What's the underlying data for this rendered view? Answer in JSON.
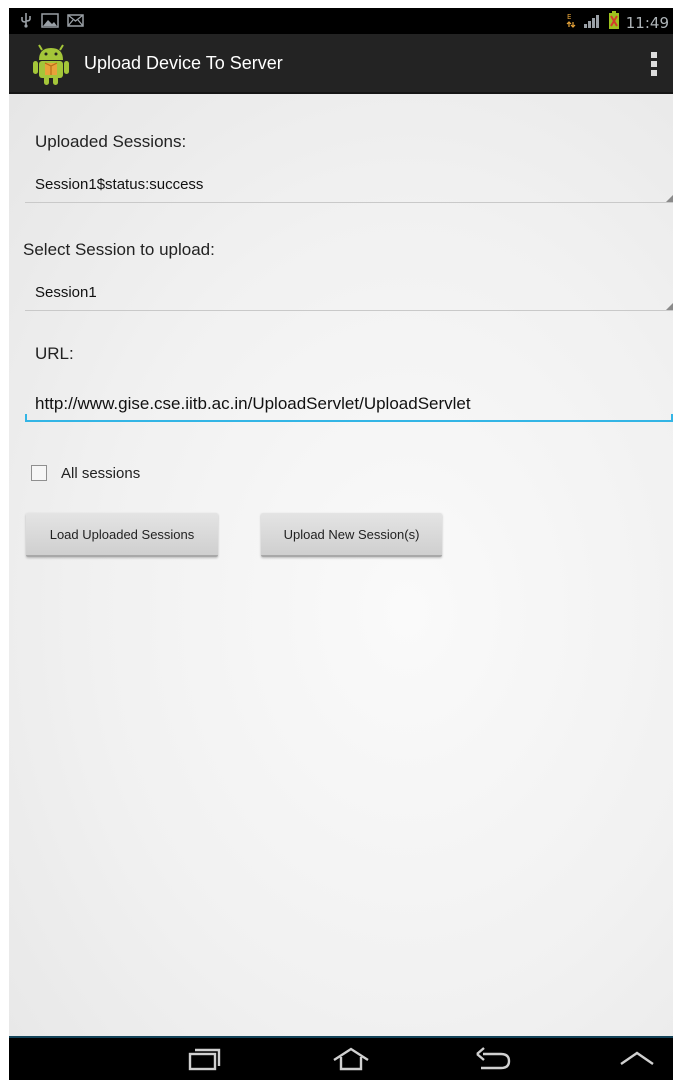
{
  "app": {
    "title": "Upload Device To Server"
  },
  "status_bar": {
    "time": "11:49",
    "left_icons": [
      "usb-icon",
      "image-notification-icon",
      "email-notification-icon"
    ],
    "right_icons": [
      "data-transfer-icon",
      "signal-icon",
      "battery-charging-icon"
    ]
  },
  "form": {
    "uploaded_sessions_label": "Uploaded Sessions:",
    "uploaded_sessions_value": "Session1$status:success",
    "select_session_label": "Select Session to upload:",
    "select_session_value": "Session1",
    "url_label": "URL:",
    "url_value": "http://www.gise.cse.iitb.ac.in/UploadServlet/UploadServlet",
    "all_sessions_label": "All sessions",
    "all_sessions_checked": false
  },
  "buttons": {
    "load_uploaded": "Load Uploaded Sessions",
    "upload_new": "Upload New Session(s)"
  },
  "navbar": {
    "icons": [
      "recent-apps-icon",
      "home-icon",
      "back-icon",
      "expand-up-icon"
    ]
  },
  "colors": {
    "accent": "#33b5e5",
    "actionbar": "#232323",
    "android_green": "#a4c639"
  }
}
